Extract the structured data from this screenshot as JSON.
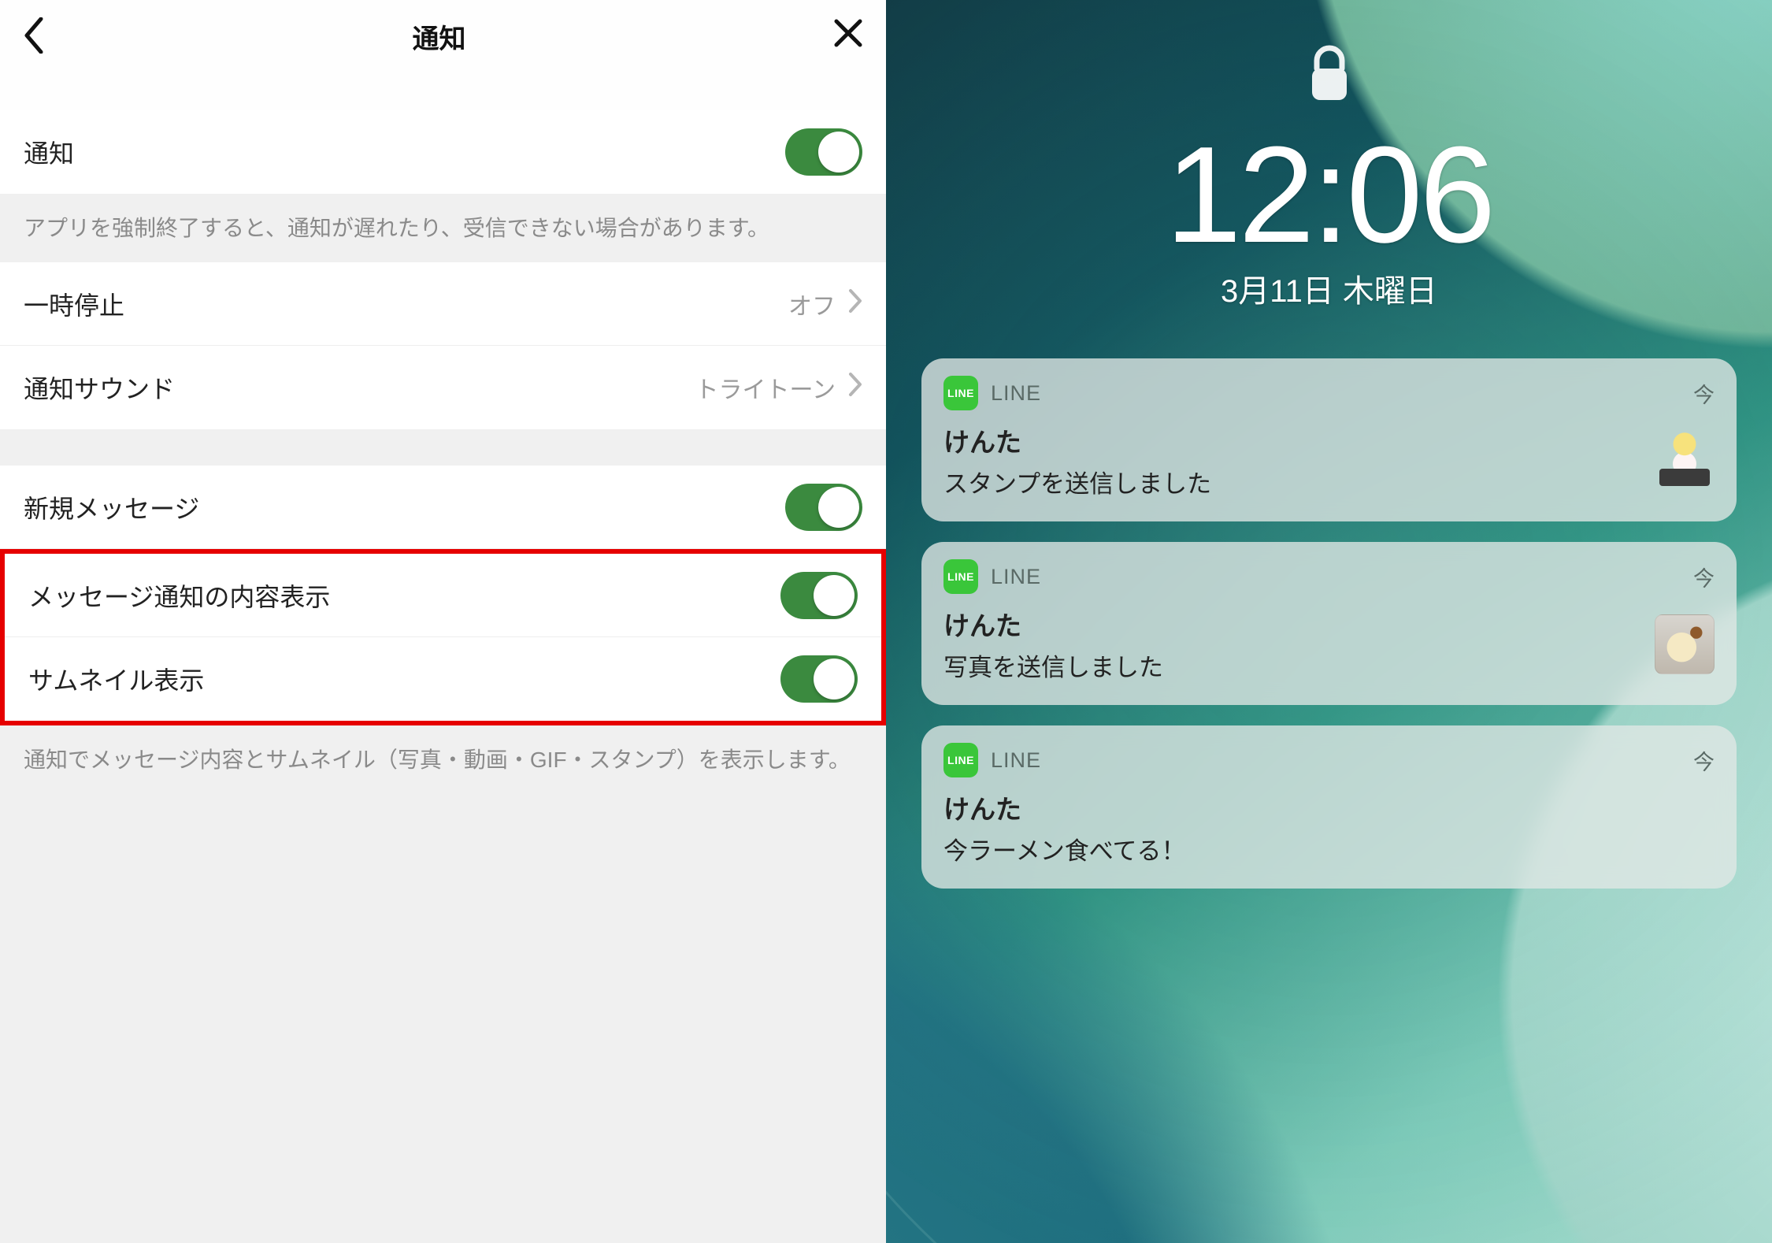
{
  "settings": {
    "header": {
      "title": "通知"
    },
    "rows": {
      "notifications": {
        "label": "通知",
        "on": true
      },
      "note1": "アプリを強制終了すると、通知が遅れたり、受信できない場合があります。",
      "pause": {
        "label": "一時停止",
        "value": "オフ"
      },
      "sound": {
        "label": "通知サウンド",
        "value": "トライトーン"
      },
      "newMessage": {
        "label": "新規メッセージ",
        "on": true
      },
      "showContent": {
        "label": "メッセージ通知の内容表示",
        "on": true
      },
      "showThumbnail": {
        "label": "サムネイル表示",
        "on": true
      },
      "note2": "通知でメッセージ内容とサムネイル（写真・動画・GIF・スタンプ）を表示します。"
    }
  },
  "lockscreen": {
    "time": "12:06",
    "date": "3月11日 木曜日",
    "appName": "LINE",
    "timeLabel": "今",
    "notifications": [
      {
        "sender": "けんた",
        "message": "スタンプを送信しました",
        "thumb": "sticker"
      },
      {
        "sender": "けんた",
        "message": "写真を送信しました",
        "thumb": "photo"
      },
      {
        "sender": "けんた",
        "message": "今ラーメン食べてる！",
        "thumb": ""
      }
    ]
  }
}
